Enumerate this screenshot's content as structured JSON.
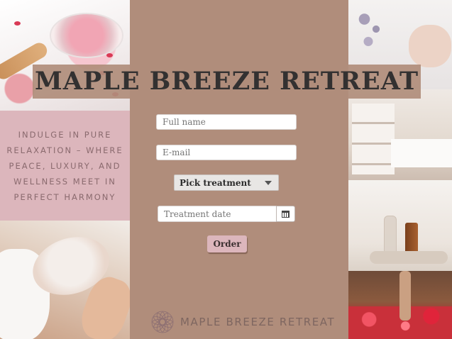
{
  "hero": {
    "title": "MAPLE BREEZE RETREAT"
  },
  "tagline": {
    "text": "INDULGE IN PURE RELAXATION – WHERE PEACE, LUXURY, AND WELLNESS MEET IN PERFECT HARMONY"
  },
  "form": {
    "name_placeholder": "Full name",
    "email_placeholder": "E-mail",
    "treatment_select_label": "Pick treatment",
    "date_placeholder": "Treatment date",
    "order_label": "Order"
  },
  "footer": {
    "brand_text": "MAPLE BREEZE RETREAT"
  },
  "icons": {
    "date_picker": "calendar-icon",
    "select_arrow": "chevron-down-icon",
    "brand_logo": "lotus-logo-icon"
  },
  "colors": {
    "background": "#b08d7b",
    "accent_pink": "#dcb6bc",
    "title_text": "#333131"
  }
}
